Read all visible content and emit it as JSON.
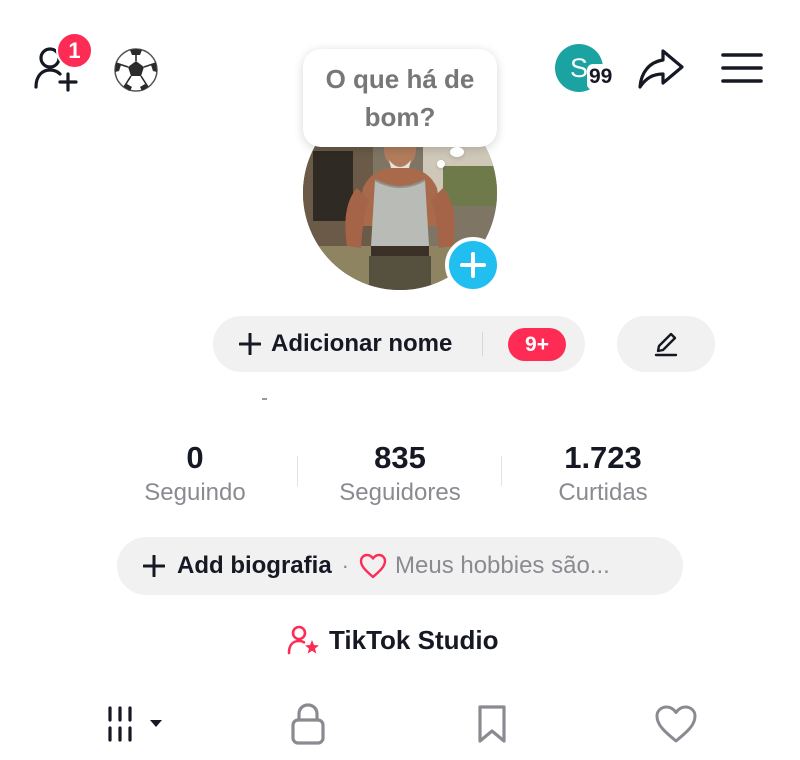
{
  "header": {
    "friend_notification_count": "1",
    "soccer_emoji": "⚽",
    "account_initial": "S",
    "account_count": "99",
    "icons": [
      "add-friend-icon",
      "soccer-ball-icon",
      "share-icon",
      "menu-icon"
    ]
  },
  "profile": {
    "bubble_text": "O que há de bom?",
    "add_name_label": "Adicionar nome",
    "name_badge": "9+"
  },
  "stats": [
    {
      "value": "0",
      "label": "Seguindo"
    },
    {
      "value": "835",
      "label": "Seguidores"
    },
    {
      "value": "1.723",
      "label": "Curtidas"
    }
  ],
  "bio": {
    "add_label": "Add biografia",
    "separator": "·",
    "hint": "Meus hobbies são..."
  },
  "studio": {
    "label": "TikTok Studio"
  },
  "tabs": [
    "videos-grid-icon",
    "private-lock-icon",
    "bookmark-icon",
    "liked-heart-icon"
  ],
  "colors": {
    "accent": "#fe2c55",
    "avatar_teal": "#1aa3a0",
    "add_photo_blue": "#20bff0",
    "pill_gray": "#f1f1f2",
    "muted_text": "#8a8b91"
  }
}
